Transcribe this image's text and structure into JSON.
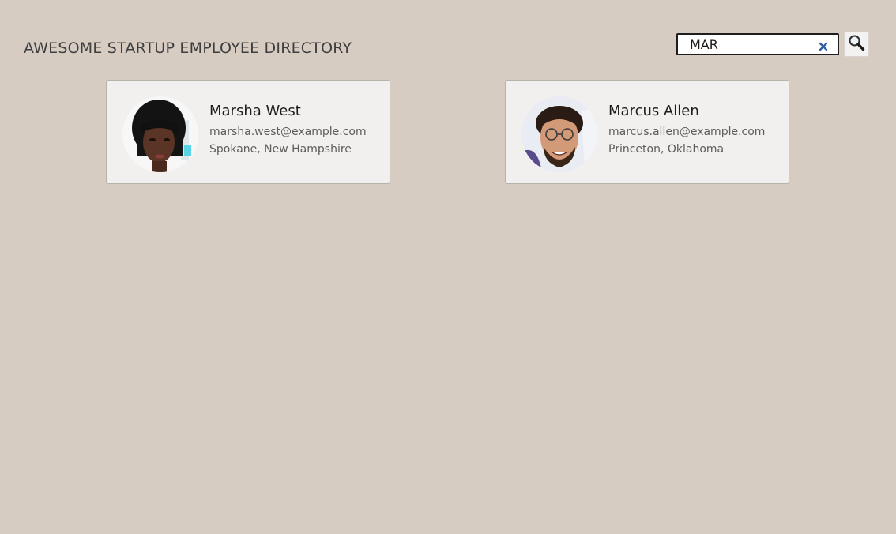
{
  "header": {
    "title": "AWESOME STARTUP EMPLOYEE DIRECTORY"
  },
  "search": {
    "value": "MAR",
    "clear_icon": "close-icon",
    "submit_icon": "magnifier-icon",
    "clear_color": "#2f5fa0"
  },
  "employees": [
    {
      "name": "Marsha West",
      "email": "marsha.west@example.com",
      "location": "Spokane, New Hampshire"
    },
    {
      "name": "Marcus Allen",
      "email": "marcus.allen@example.com",
      "location": "Princeton, Oklahoma"
    }
  ],
  "colors": {
    "background": "#d7ccc2",
    "card": "#f2f0ee",
    "card_border": "#b9b2ab"
  }
}
